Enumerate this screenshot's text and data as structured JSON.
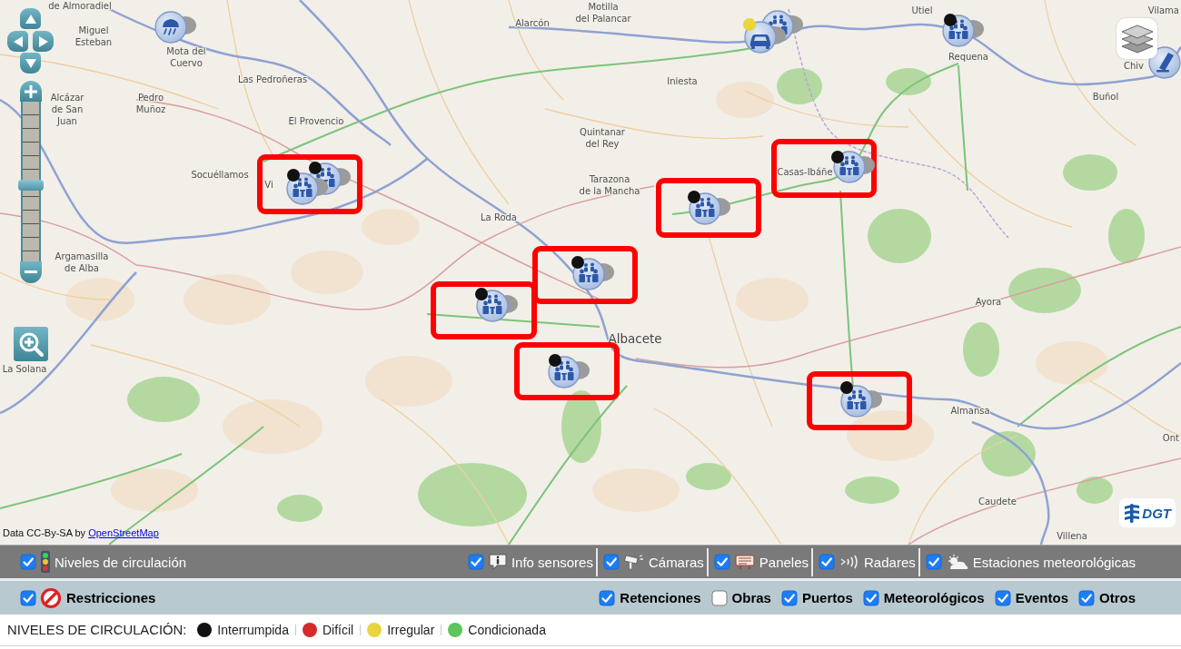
{
  "map": {
    "places": [
      {
        "lines": [
          "de Almoradiel"
        ],
        "kind": "town"
      },
      {
        "lines": [
          "Miguel",
          "Esteban"
        ],
        "kind": "town"
      },
      {
        "lines": [
          "Mota del",
          "Cuervo"
        ],
        "kind": "town"
      },
      {
        "lines": [
          "Alcázar",
          "de San",
          "Juan"
        ],
        "kind": "town"
      },
      {
        "lines": [
          "Las Pedroñeras"
        ],
        "kind": "town"
      },
      {
        "lines": [
          "Pedro",
          "Muñoz"
        ],
        "kind": "town"
      },
      {
        "lines": [
          "El Provencio"
        ],
        "kind": "town"
      },
      {
        "lines": [
          "Socuéllamos"
        ],
        "kind": "town"
      },
      {
        "lines": [
          "Vi"
        ],
        "kind": "town"
      },
      {
        "lines": [
          "Argamasilla",
          "de Alba"
        ],
        "kind": "town"
      },
      {
        "lines": [
          "La Solana"
        ],
        "kind": "town"
      },
      {
        "lines": [
          "Alarcón"
        ],
        "kind": "town"
      },
      {
        "lines": [
          "Motilla",
          "del Palancar"
        ],
        "kind": "town"
      },
      {
        "lines": [
          "Iniesta"
        ],
        "kind": "town"
      },
      {
        "lines": [
          "Quintanar",
          "del Rey"
        ],
        "kind": "town"
      },
      {
        "lines": [
          "Tarazona",
          "de la Mancha"
        ],
        "kind": "town"
      },
      {
        "lines": [
          "La Roda"
        ],
        "kind": "town"
      },
      {
        "lines": [
          "Albacete"
        ],
        "kind": "city"
      },
      {
        "lines": [
          "Casas-Ibáñe"
        ],
        "kind": "town"
      },
      {
        "lines": [
          "Utiel"
        ],
        "kind": "town"
      },
      {
        "lines": [
          "Requena"
        ],
        "kind": "town"
      },
      {
        "lines": [
          "Vilama"
        ],
        "kind": "town"
      },
      {
        "lines": [
          "Chiv"
        ],
        "kind": "town"
      },
      {
        "lines": [
          "Buñol"
        ],
        "kind": "town"
      },
      {
        "lines": [
          "Ayora"
        ],
        "kind": "town"
      },
      {
        "lines": [
          "Almansa"
        ],
        "kind": "town"
      },
      {
        "lines": [
          "Ont"
        ],
        "kind": "town"
      },
      {
        "lines": [
          "Caudete"
        ],
        "kind": "town"
      },
      {
        "lines": [
          "Villena"
        ],
        "kind": "town"
      }
    ],
    "markers": [
      {
        "kind": "weather",
        "highlighted": false
      },
      {
        "kind": "people",
        "highlighted": false
      },
      {
        "kind": "car",
        "color": "#e8d53c",
        "highlighted": false
      },
      {
        "kind": "people",
        "color": "#111111",
        "highlighted": false
      },
      {
        "kind": "panel",
        "highlighted": false
      },
      {
        "kind": "people",
        "color": "#111111",
        "highlighted": false
      },
      {
        "kind": "people",
        "color": "#111111",
        "highlighted": true
      },
      {
        "kind": "people",
        "color": "#111111",
        "highlighted": true
      },
      {
        "kind": "people",
        "color": "#111111",
        "highlighted": true
      },
      {
        "kind": "people",
        "color": "#111111",
        "highlighted": true
      },
      {
        "kind": "people",
        "color": "#111111",
        "highlighted": true
      },
      {
        "kind": "people",
        "color": "#111111",
        "highlighted": true
      },
      {
        "kind": "people",
        "color": "#111111",
        "highlighted": true
      }
    ],
    "zoom_slider": {
      "level": 0.48
    },
    "attribution": {
      "text": "Data CC-By-SA by",
      "link": "OpenStreetMap"
    },
    "logo": {
      "text": "DGT"
    }
  },
  "layers_bar": {
    "main": {
      "label": "Niveles de circulación",
      "checked": true,
      "kind": "traffic"
    },
    "items": [
      {
        "label": "Info sensores",
        "checked": true,
        "kind": "info"
      },
      {
        "label": "Cámaras",
        "checked": true,
        "kind": "camera"
      },
      {
        "label": "Paneles",
        "checked": true,
        "kind": "panel"
      },
      {
        "label": "Radares",
        "checked": true,
        "kind": "radar"
      },
      {
        "label": "Estaciones meteorológicas",
        "checked": true,
        "kind": "weather"
      }
    ]
  },
  "restrictions_bar": {
    "main": {
      "label": "Restricciones",
      "checked": true,
      "kind": "prohibition"
    },
    "items": [
      {
        "label": "Retenciones",
        "checked": true
      },
      {
        "label": "Obras",
        "checked": false
      },
      {
        "label": "Puertos",
        "checked": true
      },
      {
        "label": "Meteorológicos",
        "checked": true
      },
      {
        "label": "Eventos",
        "checked": true
      },
      {
        "label": "Otros",
        "checked": true
      }
    ]
  },
  "legend": {
    "title": "NIVELES DE CIRCULACIÓN:",
    "items": [
      {
        "label": "Interrumpida",
        "color": "#111111"
      },
      {
        "label": "Difícil",
        "color": "#d42a2a"
      },
      {
        "label": "Irregular",
        "color": "#e8d53c"
      },
      {
        "label": "Condicionada",
        "color": "#5cc55c"
      }
    ]
  }
}
